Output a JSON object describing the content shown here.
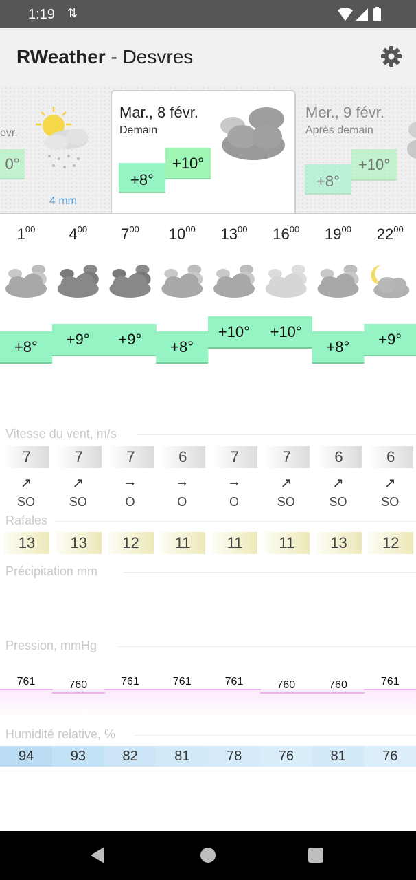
{
  "status_bar": {
    "time": "1:19"
  },
  "app": {
    "name": "RWeather",
    "separator": " - ",
    "location": "Desvres"
  },
  "days": {
    "prev": {
      "title": "evr.",
      "lo": "",
      "hi": "0°",
      "rain": "4 mm"
    },
    "current": {
      "title": "Mar., 8 févr.",
      "subtitle": "Demain",
      "lo": "+8°",
      "hi": "+10°"
    },
    "next": {
      "title": "Mer., 9 févr.",
      "subtitle": "Après demain",
      "lo": "+8°",
      "hi": "+10°"
    }
  },
  "hourly": {
    "hours": [
      {
        "h": "1",
        "m": "00"
      },
      {
        "h": "4",
        "m": "00"
      },
      {
        "h": "7",
        "m": "00"
      },
      {
        "h": "10",
        "m": "00"
      },
      {
        "h": "13",
        "m": "00"
      },
      {
        "h": "16",
        "m": "00"
      },
      {
        "h": "19",
        "m": "00"
      },
      {
        "h": "22",
        "m": "00"
      }
    ],
    "icons": [
      "cloudy-icon",
      "dark-cloudy-icon",
      "dark-cloudy-icon",
      "cloudy-icon",
      "cloudy-icon",
      "light-cloudy-icon",
      "cloudy-icon",
      "moon-cloudy-icon"
    ],
    "temps": [
      "+8°",
      "+9°",
      "+9°",
      "+8°",
      "+10°",
      "+10°",
      "+8°",
      "+9°"
    ],
    "temp_values": [
      8,
      9,
      9,
      8,
      10,
      10,
      8,
      9
    ]
  },
  "wind": {
    "label": "Vitesse du vent, m/s",
    "speeds": [
      "7",
      "7",
      "7",
      "6",
      "7",
      "7",
      "6",
      "6"
    ],
    "arrows": [
      "↗",
      "↗",
      "→",
      "→",
      "→",
      "↗",
      "↗",
      "↗"
    ],
    "directions": [
      "SO",
      "SO",
      "O",
      "O",
      "O",
      "SO",
      "SO",
      "SO"
    ]
  },
  "gusts": {
    "label": "Rafales",
    "values": [
      "13",
      "13",
      "12",
      "11",
      "11",
      "11",
      "13",
      "12"
    ]
  },
  "precipitation": {
    "label": "Précipitation  mm"
  },
  "pressure": {
    "label": "Pression, mmHg",
    "values": [
      "761",
      "760",
      "761",
      "761",
      "761",
      "760",
      "760",
      "761"
    ],
    "numeric": [
      761,
      760,
      761,
      761,
      761,
      760,
      760,
      761
    ]
  },
  "humidity": {
    "label": "Humidité relative, %",
    "values": [
      "94",
      "93",
      "82",
      "81",
      "78",
      "76",
      "81",
      "76"
    ],
    "colors": [
      "#b9dcf3",
      "#c4e2f6",
      "#cde6f7",
      "#d2e9f8",
      "#d6ebf9",
      "#d9ecf9",
      "#d2e9f8",
      "#dbeefa"
    ]
  }
}
